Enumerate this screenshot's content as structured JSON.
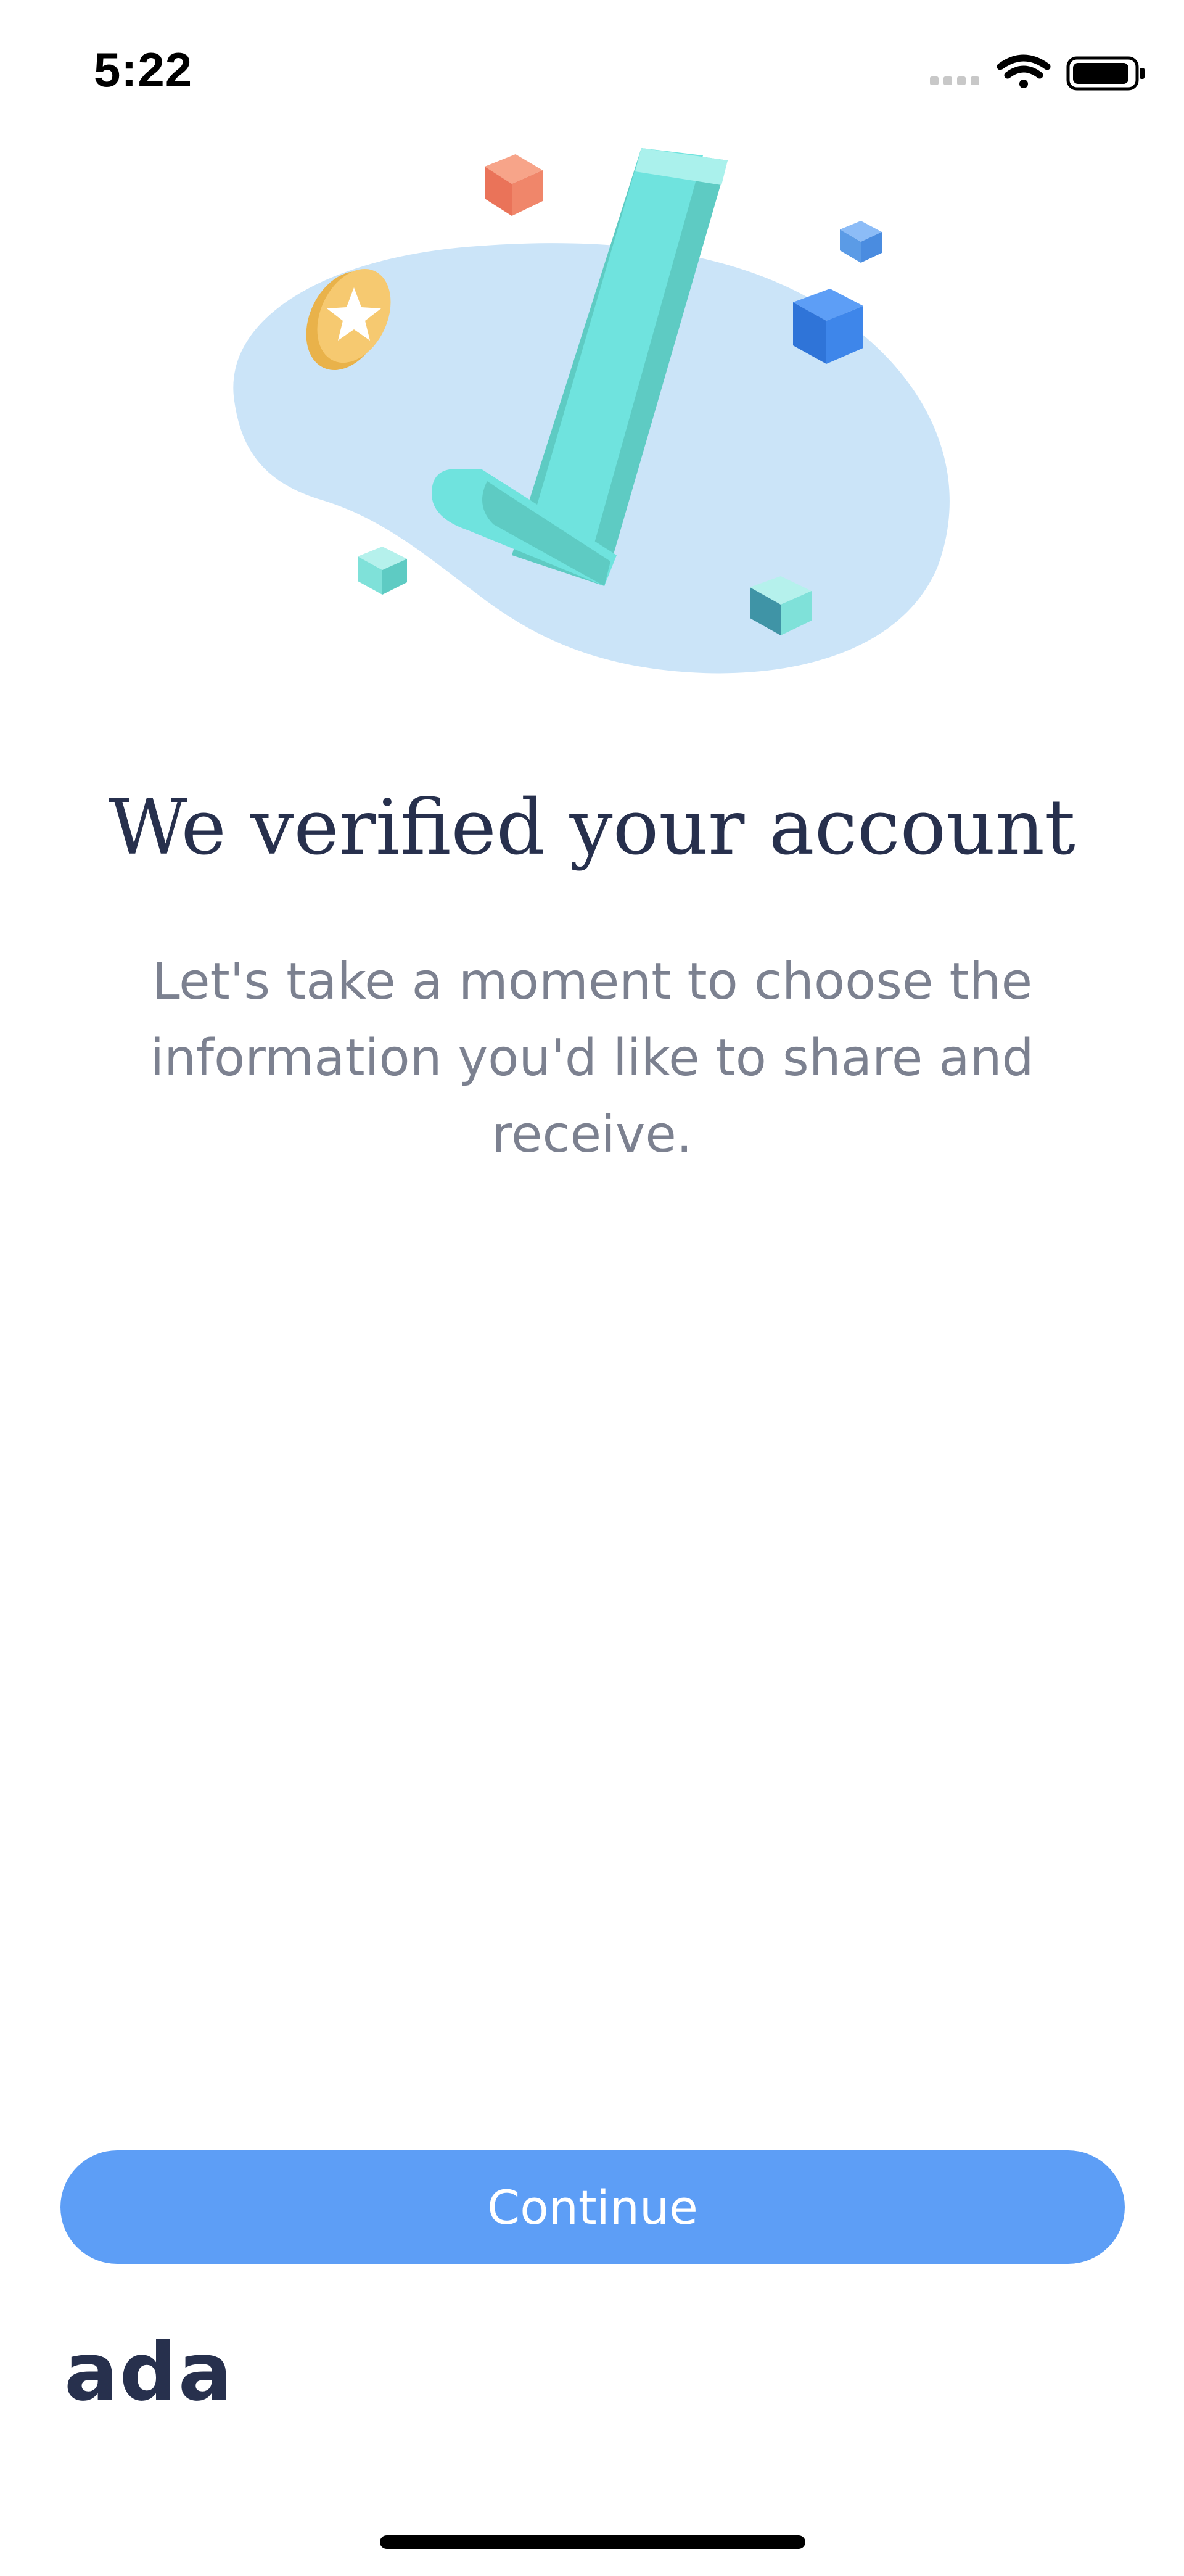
{
  "status_bar": {
    "time": "5:22",
    "icons": [
      "cellular-signal-icon",
      "wifi-icon",
      "battery-icon"
    ]
  },
  "illustration": {
    "icon": "verified-checkmark-illustration",
    "colors": {
      "blob": "#cbe4f8",
      "checkmark": "#6fe3de",
      "coin": "#f6c970",
      "cube_orange": "#f0866a",
      "cube_blue": "#3e86ea",
      "cube_teal": "#7fe1d9"
    }
  },
  "main": {
    "title": "We verified your account",
    "subtitle_line1": "Let's take a moment to choose the",
    "subtitle_line2": "information you'd like to share and receive."
  },
  "actions": {
    "continue_label": "Continue"
  },
  "brand": {
    "logo_text": "ada"
  },
  "colors": {
    "accent": "#5d9ef6",
    "title": "#27304d",
    "subtitle": "#7c8190"
  }
}
